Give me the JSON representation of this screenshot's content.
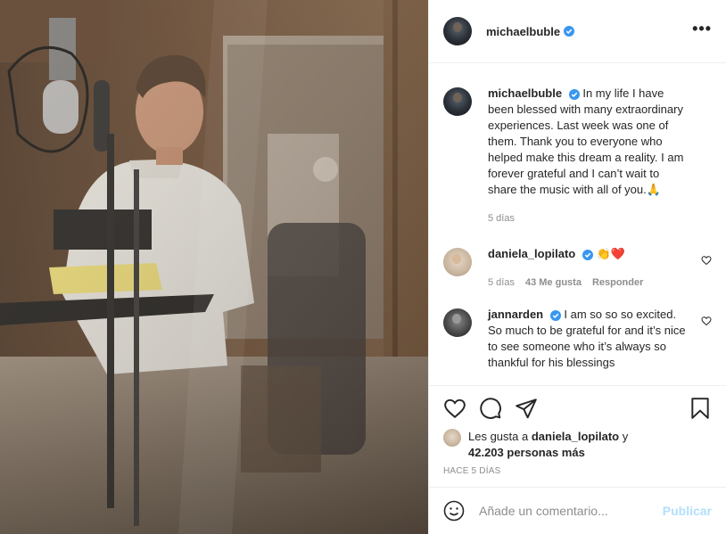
{
  "post": {
    "username": "michaelbuble",
    "caption": {
      "username": "michaelbuble",
      "text": "In my life I have been blessed with many extraordinary experiences. Last week was one of them. Thank you to everyone who helped make this dream a reality. I am forever grateful and I can’t wait to share the music with all of you.",
      "emoji": "🙏",
      "time": "5 días"
    },
    "comments": [
      {
        "username": "daniela_lopilato",
        "text": "👏❤️",
        "time": "5 días",
        "likes": "43 Me gusta",
        "reply": "Responder"
      },
      {
        "username": "jannarden",
        "text": "I am so so so excited. So much to be grateful for and it’s nice to see someone who it’s always so thankful for his blessings"
      }
    ],
    "likes": {
      "prefix": "Les gusta a",
      "user": "daniela_lopilato",
      "middle": "y",
      "count": "42.203 personas más"
    },
    "posted": "HACE 5 DÍAS",
    "composer": {
      "placeholder": "Añade un comentario...",
      "publish": "Publicar"
    },
    "icons": {
      "verified": "verified-badge-icon",
      "more": "more-options-icon",
      "like": "heart-icon",
      "comment": "comment-icon",
      "share": "paper-plane-icon",
      "save": "bookmark-icon",
      "emoji": "smiley-icon"
    },
    "colors": {
      "verified": "#3897f0",
      "publish_disabled": "#b2dffc",
      "muted": "#8e8e8e"
    }
  }
}
